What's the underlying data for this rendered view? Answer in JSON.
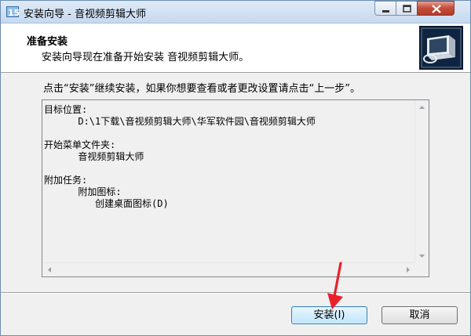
{
  "window": {
    "title": "安装向导 - 音视频剪辑大师",
    "icon": "setup-app-icon"
  },
  "header": {
    "title": "准备安装",
    "subtitle": "安装向导现在准备开始安装 音视频剪辑大师。",
    "image": "installer-computer-icon"
  },
  "main": {
    "instruction": "点击“安装”继续安装，如果你想要查看或者更改设置请点击“上一步”。",
    "summary_text": "目标位置:\n      D:\\1下载\\音视频剪辑大师\\华军软件园\\音视频剪辑大师\n\n开始菜单文件夹:\n      音视频剪辑大师\n\n附加任务:\n      附加图标:\n         创建桌面图标(D)"
  },
  "buttons": {
    "install": "安装(I)",
    "cancel": "取消"
  },
  "colors": {
    "annotation_arrow": "#e8202a",
    "close_button": "#c7503d",
    "default_button_border": "#3c7fb1"
  }
}
